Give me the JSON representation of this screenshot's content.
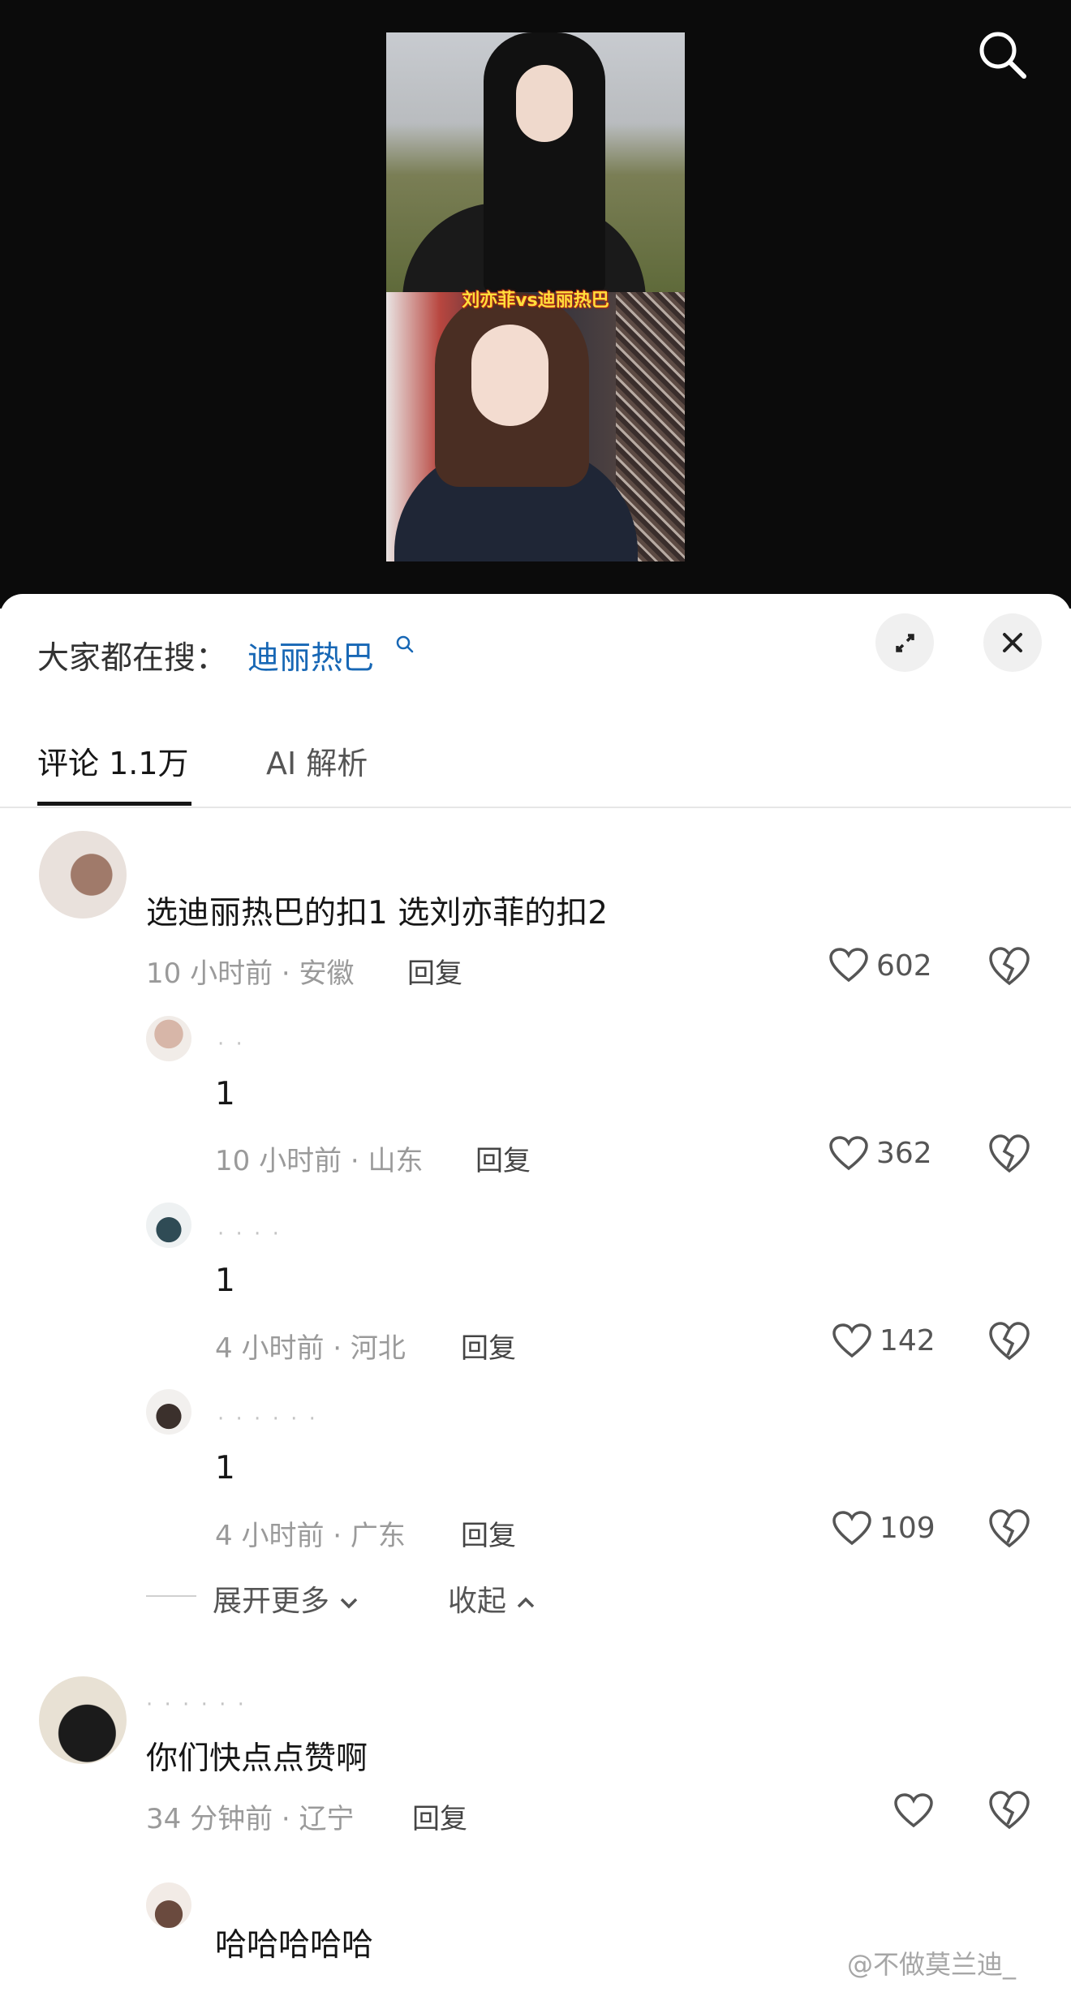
{
  "video": {
    "caption": "刘亦菲vs迪丽热巴"
  },
  "top": {
    "search_icon": "search-icon"
  },
  "sheet": {
    "hot_search_label": "大家都在搜：",
    "hot_search_term": "迪丽热巴",
    "expand_icon": "expand-icon",
    "close_icon": "close-icon"
  },
  "tabs": [
    {
      "label": "评论 1.1万",
      "active": true
    },
    {
      "label": "AI 解析",
      "active": false
    }
  ],
  "comments": [
    {
      "text": "选迪丽热巴的扣1 选刘亦菲的扣2",
      "time_location": "10 小时前 · 安徽",
      "reply": "回复",
      "likes": "602"
    },
    {
      "text": "1",
      "time_location": "10 小时前 · 山东",
      "reply": "回复",
      "likes": "362"
    },
    {
      "text": "1",
      "time_location": "4 小时前 · 河北",
      "reply": "回复",
      "likes": "142"
    },
    {
      "text": "1",
      "time_location": "4 小时前 · 广东",
      "reply": "回复",
      "likes": "109"
    },
    {
      "text": "你们快点点赞啊",
      "time_location": "34 分钟前 · 辽宁",
      "reply": "回复",
      "likes": ""
    },
    {
      "text": "哈哈哈哈哈"
    }
  ],
  "thread": {
    "expand_more": "展开更多",
    "collapse": "收起"
  },
  "watermark": "@不做莫兰迪_",
  "colors": {
    "link": "#1767b5",
    "text": "#161616",
    "meta": "#9a9a9a"
  }
}
